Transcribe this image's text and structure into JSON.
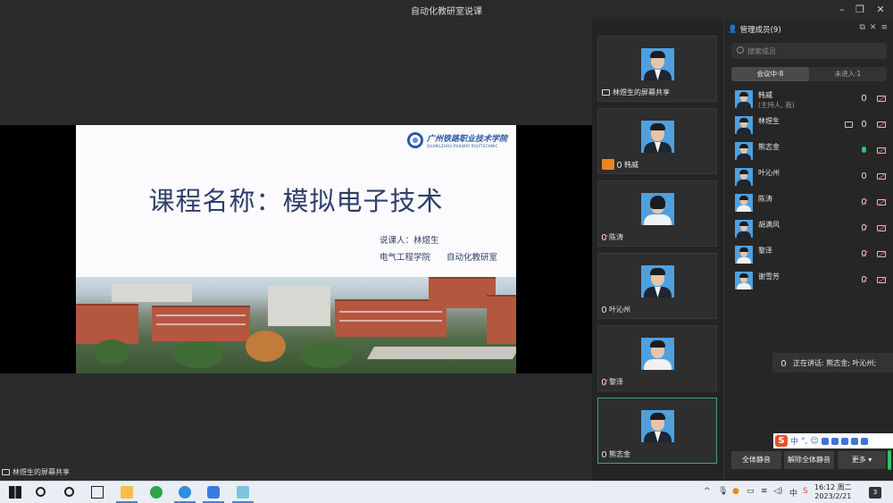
{
  "window": {
    "title": "自动化教研室说课"
  },
  "slide": {
    "logo_cn": "广州铁路职业技术学院",
    "logo_en": "GUANGZHOU RAILWAY POLYTECHNIC",
    "title": "课程名称：模拟电子技术",
    "presenter": "说课人：林煜生",
    "department": "电气工程学院",
    "lab": "自动化教研室"
  },
  "share_label": "林煜生的屏幕共享",
  "gallery": [
    {
      "label": "林煜生的屏幕共享",
      "icon": "screen-share-icon"
    },
    {
      "label": "韩威",
      "icon": "host-icon"
    },
    {
      "label": "陈涛",
      "icon": "mic-muted-icon"
    },
    {
      "label": "叶沁州",
      "icon": "mic-icon"
    },
    {
      "label": "黎泽",
      "icon": "mic-muted-icon"
    },
    {
      "label": "熊志金",
      "icon": "mic-icon"
    }
  ],
  "panel": {
    "title": "管理成员(9)",
    "search_placeholder": "搜索成员",
    "tab_in": "会议中·8",
    "tab_out": "未进入·1",
    "members": [
      {
        "name": "韩威",
        "sub": "(主持人, 我)",
        "mic": "on",
        "cam": "off"
      },
      {
        "name": "林煜生",
        "sub": "",
        "mic": "on",
        "cam": "off",
        "share": true
      },
      {
        "name": "熊志金",
        "sub": "",
        "mic": "speaking",
        "cam": "off"
      },
      {
        "name": "叶沁州",
        "sub": "",
        "mic": "on",
        "cam": "off"
      },
      {
        "name": "陈涛",
        "sub": "",
        "mic": "muted",
        "cam": "off"
      },
      {
        "name": "胡满风",
        "sub": "",
        "mic": "muted",
        "cam": "off"
      },
      {
        "name": "黎泽",
        "sub": "",
        "mic": "muted",
        "cam": "off"
      },
      {
        "name": "谢雪芳",
        "sub": "",
        "mic": "muted",
        "cam": "off"
      }
    ],
    "speaking": "正在讲话: 熊志金; 叶沁州;",
    "btn_mute_all": "全体静音",
    "btn_unmute_all": "解除全体静音",
    "btn_more": "更多 ▾",
    "ime_lang": "中"
  },
  "taskbar": {
    "time": "16:12 周二",
    "date": "2023/2/21",
    "notifications": "3"
  },
  "colors": {
    "accent_green": "#33c26a",
    "slide_title": "#2f3e6b",
    "avatar_bg": "#4fa0df"
  }
}
